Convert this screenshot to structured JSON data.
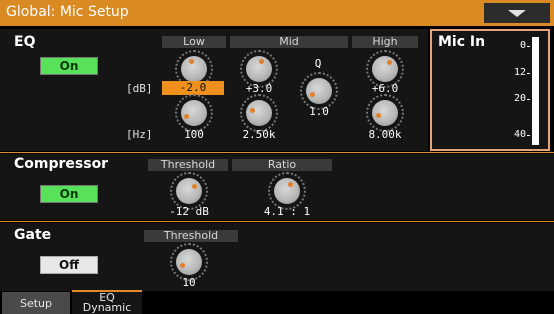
{
  "title": "Global: Mic Setup",
  "eq": {
    "label": "EQ",
    "toggle": "On",
    "headers": {
      "low": "Low",
      "mid": "Mid",
      "high": "High",
      "q": "Q"
    },
    "gain_unit": "[dB]",
    "freq_unit": "[Hz]",
    "gains": {
      "low": "-2.0",
      "mid": "+3.0",
      "high": "+6.0"
    },
    "q_value": "1.0",
    "freqs": {
      "low": "100",
      "mid": "2.50k",
      "high": "8.00k"
    }
  },
  "mic_in": {
    "label": "Mic In",
    "scale": [
      "0",
      "12",
      "20",
      "40"
    ]
  },
  "compressor": {
    "label": "Compressor",
    "toggle": "On",
    "threshold_header": "Threshold",
    "ratio_header": "Ratio",
    "threshold_value": "-12 dB",
    "ratio_value": "4.1 : 1"
  },
  "gate": {
    "label": "Gate",
    "toggle": "Off",
    "threshold_header": "Threshold",
    "threshold_value": "10"
  },
  "tabs": [
    {
      "label": "Setup"
    },
    {
      "label_line1": "EQ",
      "label_line2": "Dynamic"
    }
  ],
  "colors": {
    "accent": "#d98a22",
    "on": "#58e25a",
    "highlight": "#f0901c"
  }
}
